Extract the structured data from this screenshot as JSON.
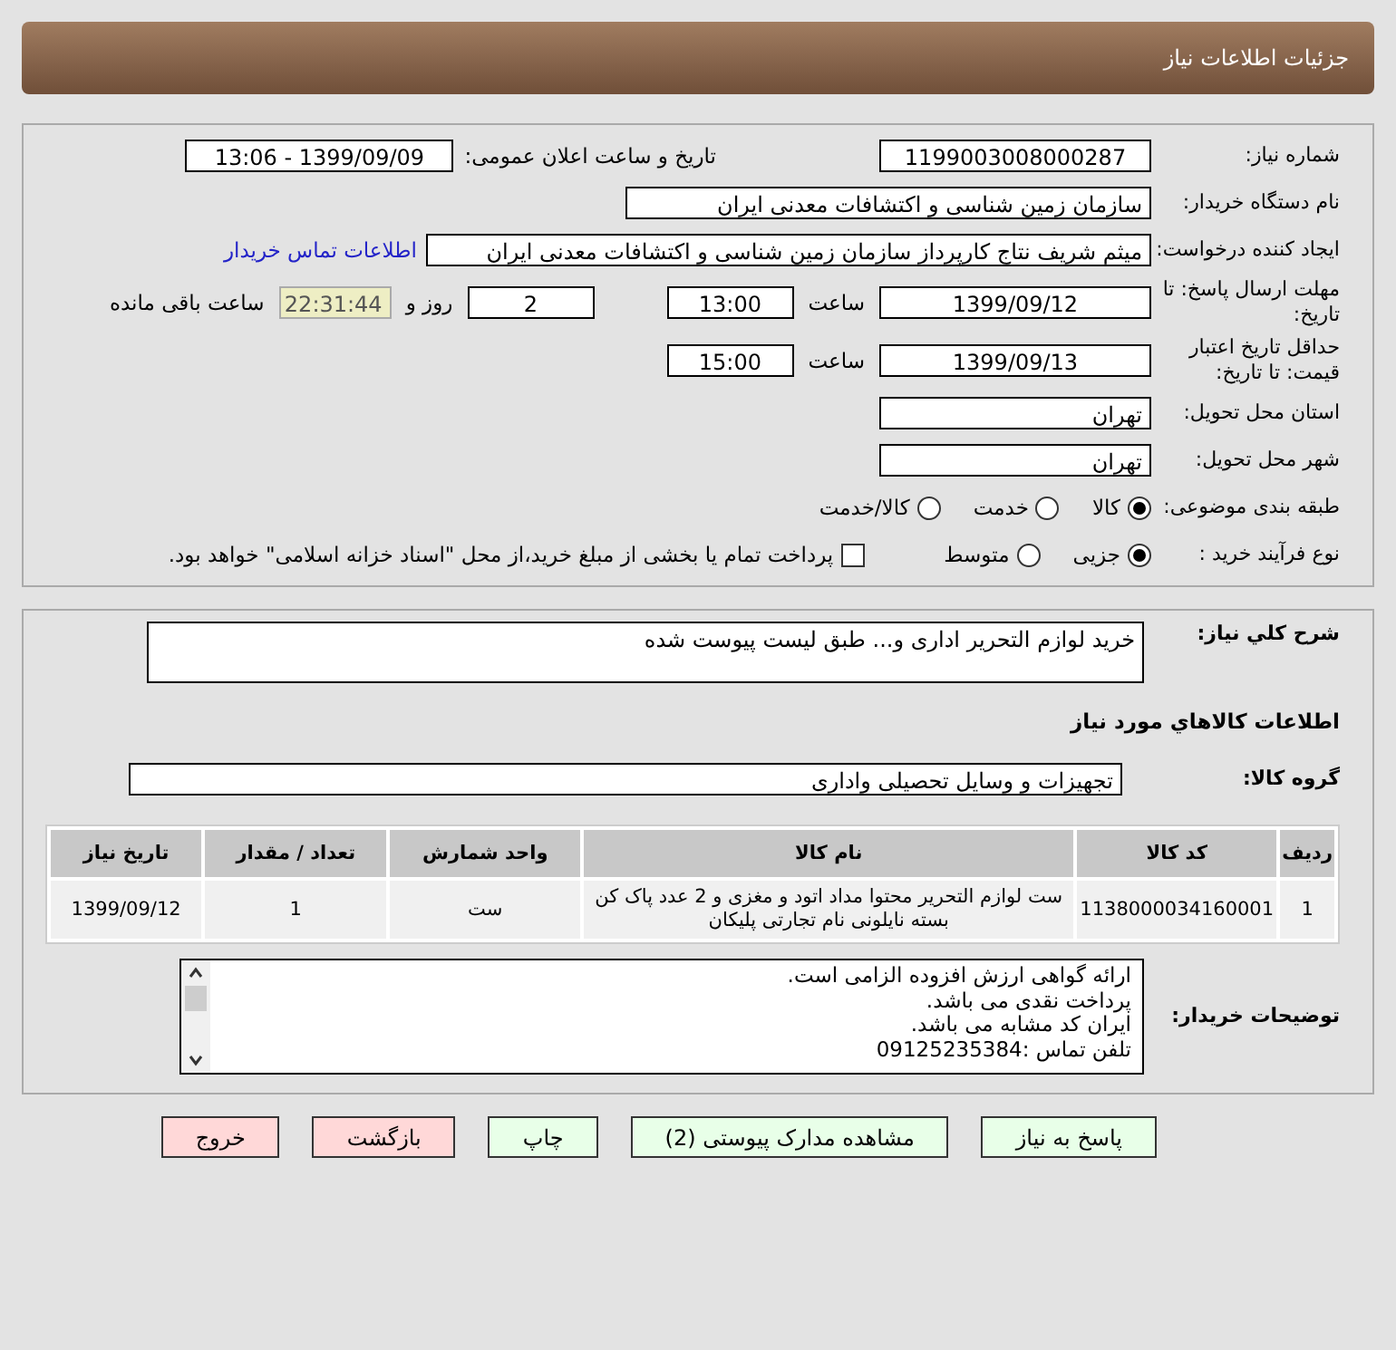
{
  "header": {
    "title": "جزئیات اطلاعات نیاز"
  },
  "details": {
    "need_number": {
      "label": "شماره نیاز:",
      "value": "1199003008000287"
    },
    "announce": {
      "label": "تاریخ و ساعت اعلان عمومی:",
      "value": "1399/09/09 - 13:06"
    },
    "buyer_org": {
      "label": "نام دستگاه خریدار:",
      "value": "سازمان زمین شناسی و اکتشافات معدنی ایران"
    },
    "requester": {
      "label": "ایجاد کننده درخواست:",
      "value": "میثم شریف نتاج کارپرداز سازمان زمین شناسی و اکتشافات معدنی ایران",
      "link": "اطلاعات تماس خریدار"
    },
    "reply_deadline": {
      "label": "مهلت ارسال پاسخ: تا تاریخ:",
      "date": "1399/09/12",
      "time_label": "ساعت",
      "time": "13:00",
      "days": "2",
      "days_label": "روز و",
      "remaining": "22:31:44",
      "remaining_label": "ساعت باقی مانده"
    },
    "validity": {
      "label": "حداقل تاریخ اعتبار قیمت: تا تاریخ:",
      "date": "1399/09/13",
      "time_label": "ساعت",
      "time": "15:00"
    },
    "province": {
      "label": "استان محل تحویل:",
      "value": "تهران"
    },
    "city": {
      "label": "شهر محل تحویل:",
      "value": "تهران"
    },
    "category": {
      "label": "طبقه بندی موضوعی:",
      "options": [
        {
          "label": "کالا",
          "selected": true
        },
        {
          "label": "خدمت",
          "selected": false
        },
        {
          "label": "کالا/خدمت",
          "selected": false
        }
      ]
    },
    "process": {
      "label": "نوع فرآیند خرید :",
      "options": [
        {
          "label": "جزیی",
          "selected": true
        },
        {
          "label": "متوسط",
          "selected": false
        }
      ],
      "payment": {
        "label": "پرداخت تمام یا بخشی از مبلغ خرید،از محل \"اسناد خزانه اسلامی\" خواهد بود.",
        "checked": false
      }
    }
  },
  "needs": {
    "description": {
      "label": "شرح كلي نياز:",
      "value": "خرید لوازم التحریر اداری و... طبق لیست پیوست شده"
    },
    "goods_title": "اطلاعات كالاهاي مورد نياز",
    "goods_group": {
      "label": "گروه کالا:",
      "value": "تجهیزات و وسایل تحصیلی واداری"
    },
    "table": {
      "columns": [
        "ردیف",
        "کد کالا",
        "نام کالا",
        "واحد شمارش",
        "تعداد / مقدار",
        "تاریخ نیاز"
      ],
      "rows": [
        [
          "1",
          "1138000034160001",
          "ست لوازم التحریر محتوا مداد اتود و مغزی و 2 عدد پاک کن بسته نایلونی نام تجارتی پلیکان",
          "ست",
          "1",
          "1399/09/12"
        ]
      ]
    },
    "buyer_notes": {
      "label": "توضیحات خریدار:",
      "lines": [
        "ارائه گواهی ارزش افزوده الزامی است.",
        "پرداخت نقدی می باشد.",
        "ایران کد مشابه می باشد.",
        "تلفن تماس :09125235384"
      ]
    }
  },
  "buttons": [
    {
      "label": "پاسخ به نیاز",
      "kind": "go"
    },
    {
      "label": "مشاهده مدارک پیوستی (2)",
      "kind": "go"
    },
    {
      "label": "چاپ",
      "kind": "go"
    },
    {
      "label": "بازگشت",
      "kind": "stop"
    },
    {
      "label": "خروج",
      "kind": "stop"
    }
  ]
}
